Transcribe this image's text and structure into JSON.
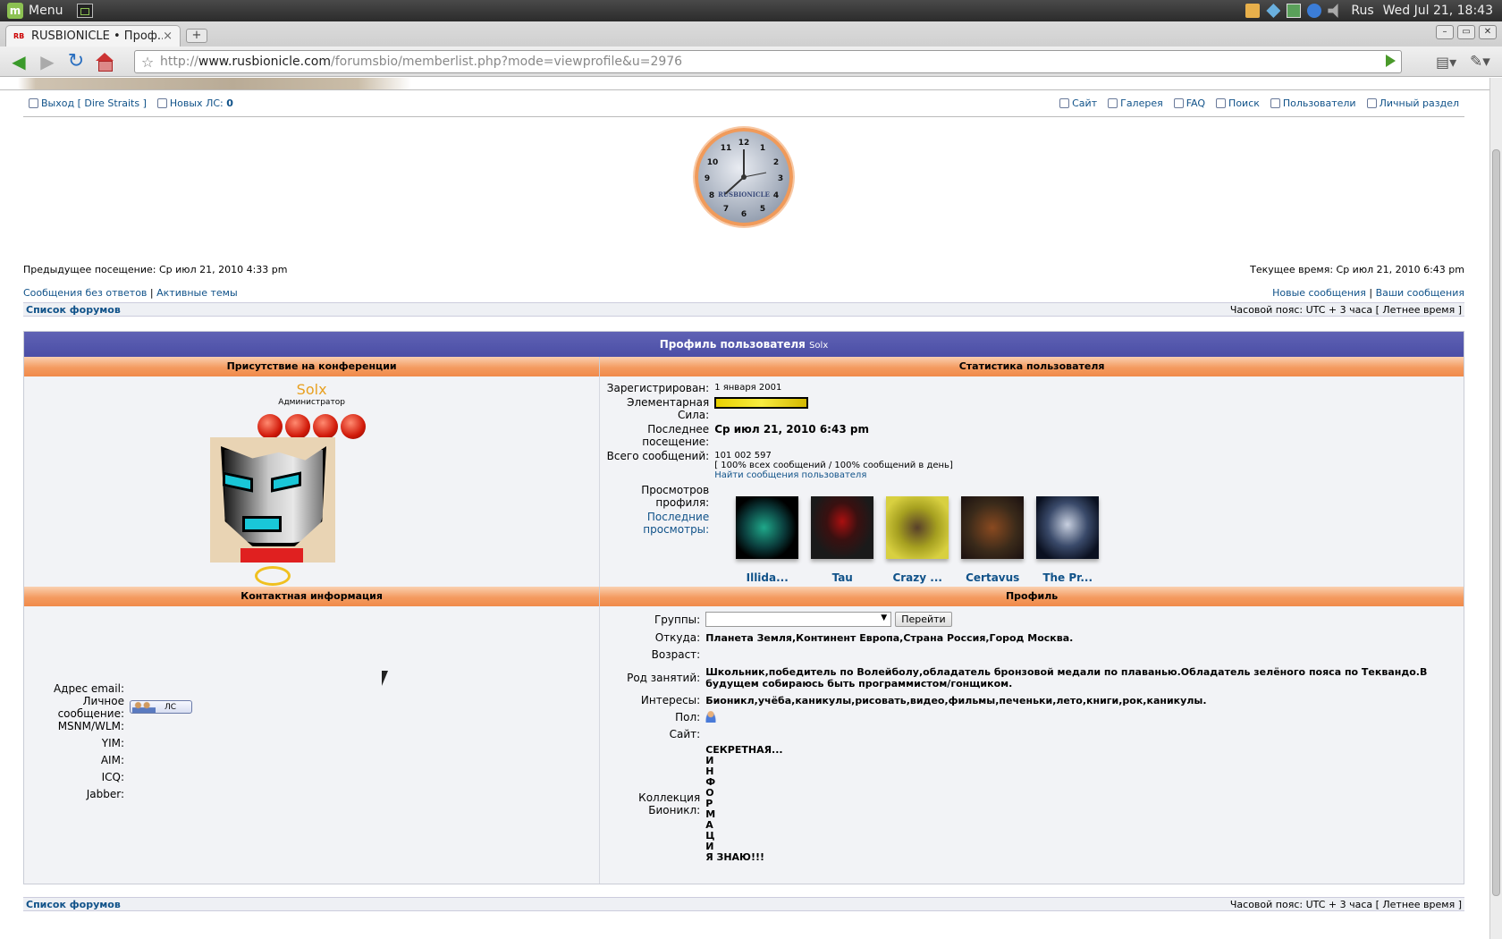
{
  "os": {
    "menu_label": "Menu",
    "keyboard_layout": "Rus",
    "datetime": "Wed Jul 21, 18:43"
  },
  "browser": {
    "tab_title": "RUSBIONICLE • Проф...",
    "tab_favicon": "RB",
    "new_tab": "+",
    "url_scheme": "http://",
    "url_host": "www.rusbionicle.com",
    "url_path": "/forumsbio/memberlist.php?mode=viewprofile&u=2976"
  },
  "header": {
    "logout": "Выход [ Dire Straits ]",
    "new_pm_label": "Новых ЛС: ",
    "new_pm_count": "0",
    "links": [
      "Сайт",
      "Галерея",
      "FAQ",
      "Поиск",
      "Пользователи",
      "Личный раздел"
    ]
  },
  "clock": {
    "numbers": [
      "12",
      "1",
      "2",
      "3",
      "4",
      "5",
      "6",
      "7",
      "8",
      "9",
      "10",
      "11"
    ],
    "label": "RUSBIONICLE"
  },
  "visits": {
    "previous": "Предыдущее посещение: Ср июл 21, 2010 4:33 pm",
    "current": "Текущее время: Ср июл 21, 2010 6:43 pm"
  },
  "quick_links": {
    "unanswered": "Сообщения без ответов",
    "separator": "|",
    "active": "Активные темы",
    "new_posts": "Новые сообщения",
    "your_posts": "Ваши сообщения"
  },
  "navbar": {
    "forum_index": "Список форумов",
    "timezone": "Часовой пояс: UTC + 3 часа [ Летнее время ]"
  },
  "profile_header": {
    "title": "Профиль пользователя ",
    "username": "Solx"
  },
  "sections": {
    "presence": "Присутствие на конференции",
    "stats": "Статистика пользователя",
    "contact": "Контактная информация",
    "profile": "Профиль"
  },
  "presence": {
    "name": "Solx",
    "rank": "Администратор"
  },
  "stats": {
    "registered_label": "Зарегистрирован:",
    "registered_value": "1 января 2001",
    "power_label": "Элементарная Сила:",
    "last_visit_label": "Последнее посещение:",
    "last_visit_value": "Ср июл 21, 2010 6:43 pm",
    "posts_label": "Всего сообщений:",
    "posts_value": "101 002 597",
    "posts_pct_line": "[ 100%  всех сообщений / 100% сообщений в день]",
    "find_posts": "Найти сообщения пользователя",
    "views_label": "Просмотров профиля:",
    "recent_label": "Последние просмотры:",
    "viewers": [
      "Illida...",
      "Tau",
      "Crazy ...",
      "Certavus",
      "The Pr..."
    ]
  },
  "contact": {
    "email_label": "Адрес email:",
    "pm_label": "Личное сообщение:",
    "pm_button": "ЛС",
    "msnm_label": "MSNM/WLM:",
    "yim_label": "YIM:",
    "aim_label": "AIM:",
    "icq_label": "ICQ:",
    "jabber_label": "Jabber:"
  },
  "profile": {
    "groups_label": "Группы:",
    "groups_value": "",
    "go_button": "Перейти",
    "location_label": "Откуда:",
    "location_value": "Планета Земля,Континент Европа,Страна Россия,Город Москва.",
    "age_label": "Возраст:",
    "occupation_label": "Род занятий:",
    "occupation_value": "Школьник,победитель по Волейболу,обладатель бронзовой медали по плаванью.Обладатель зелёного пояса по Теквандо.В будущем собираюсь быть программистом/гонщиком.",
    "interests_label": "Интересы:",
    "interests_value": "Бионикл,учёба,каникулы,рисовать,видео,фильмы,печеньки,лето,книги,рок,каникулы.",
    "gender_label": "Пол:",
    "site_label": "Сайт:",
    "collection_label": "Коллекция Бионикл:",
    "collection_lines": [
      "СЕКРЕТНАЯ...",
      "И",
      "Н",
      "Ф",
      "О",
      "Р",
      "М",
      "А",
      "Ц",
      "И",
      "Я ЗНАЮ!!!"
    ]
  }
}
